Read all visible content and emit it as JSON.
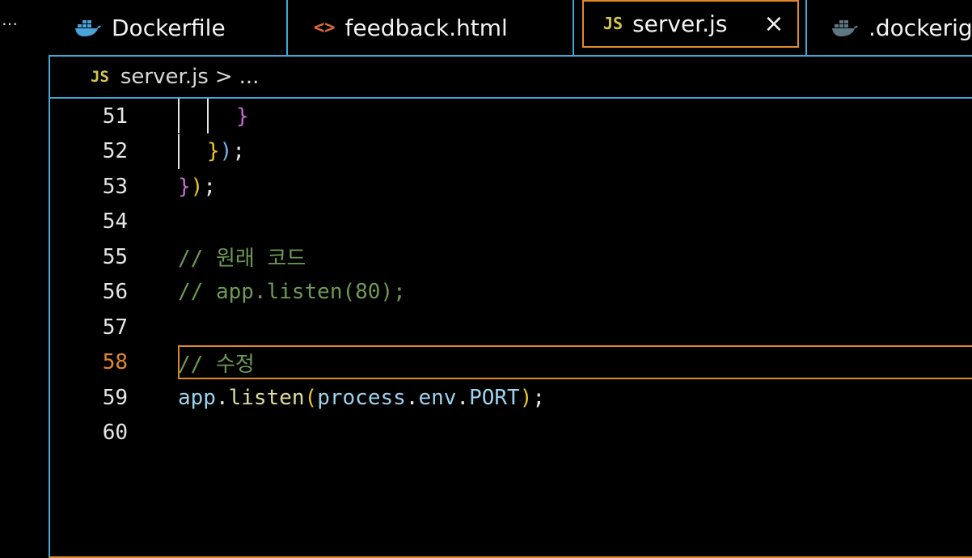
{
  "overflow_menu": "…",
  "tabs": [
    {
      "label": "Dockerfile",
      "icon": "docker-whale-icon"
    },
    {
      "label": "feedback.html",
      "icon": "html-code-icon",
      "badge": "<>"
    },
    {
      "label": "server.js",
      "icon": "javascript-icon",
      "badge": "JS",
      "active": true,
      "close": "×"
    },
    {
      "label": ".dockerig",
      "icon": "docker-whale-icon"
    }
  ],
  "breadcrumb": {
    "badge": "JS",
    "file": "server.js",
    "separator": ">",
    "more": "..."
  },
  "editor": {
    "current_line": 58,
    "lines": [
      {
        "number": "51",
        "parts": [
          [
            "pk",
            "}"
          ]
        ]
      },
      {
        "number": "52",
        "parts": [
          [
            "yl",
            "}"
          ],
          [
            "bl",
            ")"
          ],
          [
            "pl",
            ";"
          ]
        ]
      },
      {
        "number": "53",
        "parts": [
          [
            "pk",
            "}"
          ],
          [
            "yl",
            ")"
          ],
          [
            "pl",
            ";"
          ]
        ]
      },
      {
        "number": "54",
        "parts": []
      },
      {
        "number": "55",
        "parts": [
          [
            "cmt",
            "// 원래 코드"
          ]
        ]
      },
      {
        "number": "56",
        "parts": [
          [
            "cmt",
            "// app.listen(80);"
          ]
        ]
      },
      {
        "number": "57",
        "parts": []
      },
      {
        "number": "58",
        "parts": [
          [
            "cmt",
            "// 수정"
          ]
        ]
      },
      {
        "number": "59",
        "parts": [
          [
            "var",
            "app"
          ],
          [
            "pl",
            "."
          ],
          [
            "fn",
            "listen"
          ],
          [
            "yl",
            "("
          ],
          [
            "var",
            "process"
          ],
          [
            "pl",
            "."
          ],
          [
            "var",
            "env"
          ],
          [
            "pl",
            "."
          ],
          [
            "var",
            "PORT"
          ],
          [
            "yl",
            ")"
          ],
          [
            "pl",
            ";"
          ]
        ]
      },
      {
        "number": "60",
        "parts": []
      }
    ]
  },
  "colors": {
    "accent_orange": "#e0892b",
    "border_blue": "#3fa8d6",
    "comment_green": "#6e9a55",
    "js_yellow": "#d4c94a"
  }
}
